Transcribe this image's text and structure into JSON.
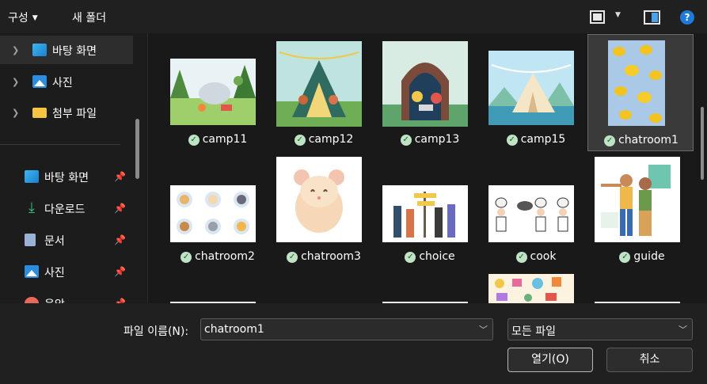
{
  "toolbar": {
    "organize_label": "구성",
    "new_folder_label": "새 폴더",
    "help_label": "?"
  },
  "sidebar": {
    "tree": [
      {
        "label": "바탕 화면",
        "icon": "desktop-icon",
        "selected": true
      },
      {
        "label": "사진",
        "icon": "photos-icon",
        "selected": false
      },
      {
        "label": "첨부 파일",
        "icon": "folder-icon",
        "selected": false
      }
    ],
    "quick_access": [
      {
        "label": "바탕 화면",
        "icon": "desktop-icon"
      },
      {
        "label": "다운로드",
        "icon": "download-icon"
      },
      {
        "label": "문서",
        "icon": "documents-icon"
      },
      {
        "label": "사진",
        "icon": "photos-icon"
      },
      {
        "label": "음악",
        "icon": "music-icon"
      }
    ]
  },
  "files": [
    {
      "name": "camp11",
      "selected": false
    },
    {
      "name": "camp12",
      "selected": false
    },
    {
      "name": "camp13",
      "selected": false
    },
    {
      "name": "camp15",
      "selected": false
    },
    {
      "name": "chatroom1",
      "selected": true
    },
    {
      "name": "chatroom2",
      "selected": false
    },
    {
      "name": "chatroom3",
      "selected": false
    },
    {
      "name": "choice",
      "selected": false
    },
    {
      "name": "cook",
      "selected": false
    },
    {
      "name": "guide",
      "selected": false
    }
  ],
  "footer": {
    "filename_label": "파일 이름(N):",
    "filename_value": "chatroom1",
    "filetype_value": "모든 파일",
    "open_label": "열기(O)",
    "cancel_label": "취소"
  },
  "colors": {
    "background": "#191919",
    "toolbar": "#202020",
    "accent": "#1e7ad6",
    "sync_check": "#bfe3c4"
  }
}
